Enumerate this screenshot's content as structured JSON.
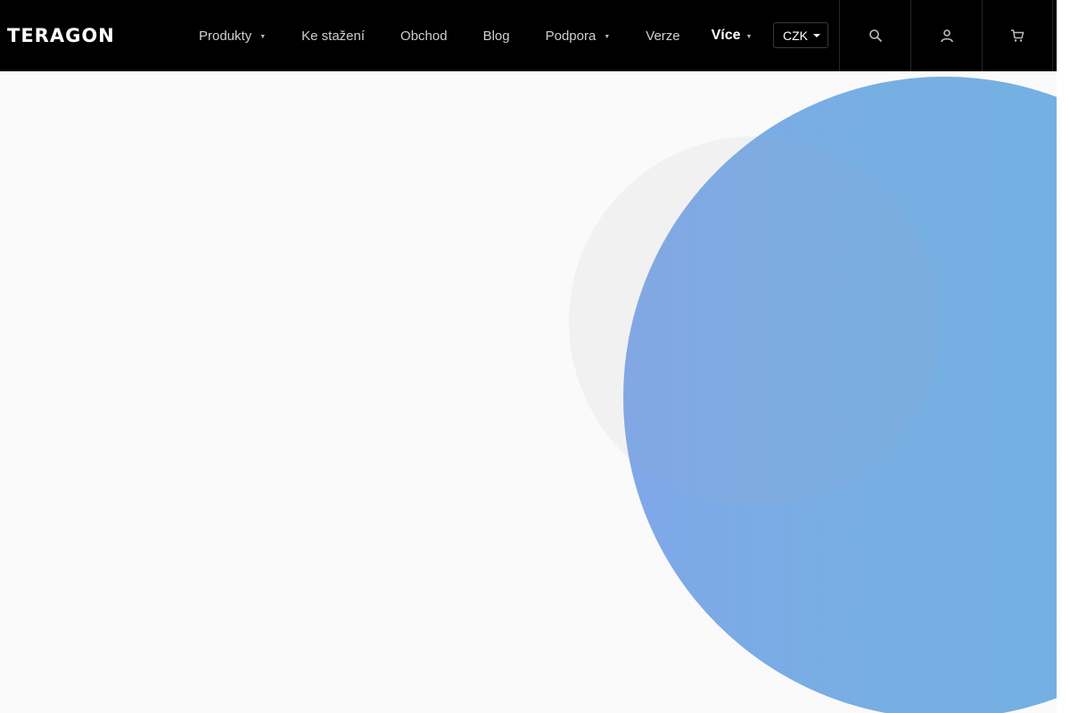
{
  "header": {
    "logo_text": "TERAGON",
    "nav": [
      {
        "label": "Produkty",
        "has_dropdown": true
      },
      {
        "label": "Ke stažení",
        "has_dropdown": false
      },
      {
        "label": "Obchod",
        "has_dropdown": false
      },
      {
        "label": "Blog",
        "has_dropdown": false
      },
      {
        "label": "Podpora",
        "has_dropdown": true
      },
      {
        "label": "Verze",
        "has_dropdown": false
      },
      {
        "label": "Více",
        "has_dropdown": true
      }
    ],
    "currency": "CZK",
    "icons": [
      "search-icon",
      "user-icon",
      "cart-icon"
    ]
  },
  "colors": {
    "header_bg": "#000000",
    "page_bg": "#fafafa",
    "accent_blue": "#6fb0e0",
    "accent_blue_dark": "#7aa4e8",
    "grey_circle": "#f1f1f1"
  }
}
